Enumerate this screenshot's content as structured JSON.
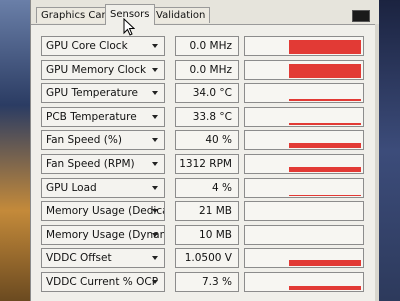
{
  "tabs": [
    {
      "label": "Graphics Card",
      "active": false
    },
    {
      "label": "Sensors",
      "active": true
    },
    {
      "label": "Validation",
      "active": false
    }
  ],
  "sensors": [
    {
      "label": "GPU Core Clock",
      "value": "0.0 MHz",
      "level": 0.85
    },
    {
      "label": "GPU Memory Clock",
      "value": "0.0 MHz",
      "level": 0.85
    },
    {
      "label": "GPU Temperature",
      "value": "34.0 °C",
      "level": 0.1
    },
    {
      "label": "PCB Temperature",
      "value": "33.8 °C",
      "level": 0.1
    },
    {
      "label": "Fan Speed (%)",
      "value": "40 %",
      "level": 0.3
    },
    {
      "label": "Fan Speed (RPM)",
      "value": "1312 RPM",
      "level": 0.3
    },
    {
      "label": "GPU Load",
      "value": "4 %",
      "level": 0.05
    },
    {
      "label": "Memory Usage (Dedicated)",
      "value": "21 MB",
      "level": 0.0
    },
    {
      "label": "Memory Usage (Dynamic)",
      "value": "10 MB",
      "level": 0.0
    },
    {
      "label": "VDDC Offset",
      "value": "1.0500 V",
      "level": 0.35
    },
    {
      "label": "VDDC Current % OCP",
      "value": "7.3 %",
      "level": 0.25
    }
  ],
  "colors": {
    "graph": "#e23a35"
  }
}
